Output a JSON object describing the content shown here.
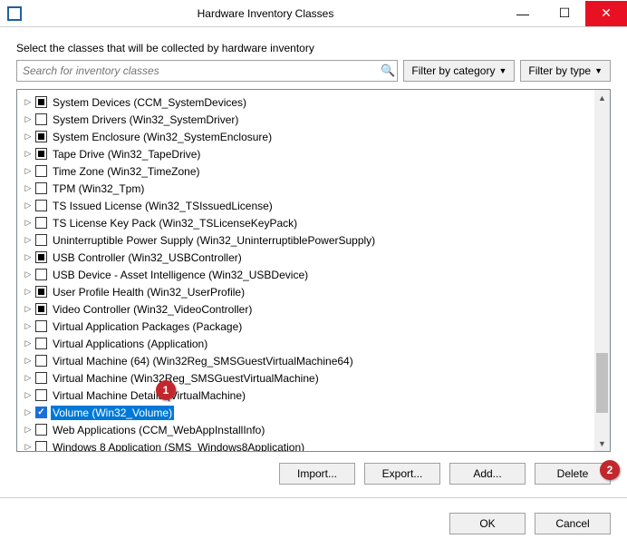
{
  "window": {
    "title": "Hardware Inventory Classes"
  },
  "instruction": "Select the classes that will be collected by hardware inventory",
  "search": {
    "placeholder": "Search for inventory classes"
  },
  "filters": {
    "category": "Filter by category",
    "type": "Filter by type"
  },
  "classes": [
    {
      "label": "System Devices (CCM_SystemDevices)",
      "state": "partial",
      "selected": false
    },
    {
      "label": "System Drivers (Win32_SystemDriver)",
      "state": "unchecked",
      "selected": false
    },
    {
      "label": "System Enclosure (Win32_SystemEnclosure)",
      "state": "partial",
      "selected": false
    },
    {
      "label": "Tape Drive (Win32_TapeDrive)",
      "state": "partial",
      "selected": false
    },
    {
      "label": "Time Zone (Win32_TimeZone)",
      "state": "unchecked",
      "selected": false
    },
    {
      "label": "TPM (Win32_Tpm)",
      "state": "unchecked",
      "selected": false
    },
    {
      "label": "TS Issued License (Win32_TSIssuedLicense)",
      "state": "unchecked",
      "selected": false
    },
    {
      "label": "TS License Key Pack (Win32_TSLicenseKeyPack)",
      "state": "unchecked",
      "selected": false
    },
    {
      "label": "Uninterruptible Power Supply (Win32_UninterruptiblePowerSupply)",
      "state": "unchecked",
      "selected": false
    },
    {
      "label": "USB Controller (Win32_USBController)",
      "state": "partial",
      "selected": false
    },
    {
      "label": "USB Device - Asset Intelligence (Win32_USBDevice)",
      "state": "unchecked",
      "selected": false
    },
    {
      "label": "User Profile Health (Win32_UserProfile)",
      "state": "partial",
      "selected": false
    },
    {
      "label": "Video Controller (Win32_VideoController)",
      "state": "partial",
      "selected": false
    },
    {
      "label": "Virtual Application Packages (Package)",
      "state": "unchecked",
      "selected": false
    },
    {
      "label": "Virtual Applications (Application)",
      "state": "unchecked",
      "selected": false
    },
    {
      "label": "Virtual Machine (64) (Win32Reg_SMSGuestVirtualMachine64)",
      "state": "unchecked",
      "selected": false
    },
    {
      "label": "Virtual Machine (Win32Reg_SMSGuestVirtualMachine)",
      "state": "unchecked",
      "selected": false
    },
    {
      "label": "Virtual Machine Details (VirtualMachine)",
      "state": "unchecked",
      "selected": false
    },
    {
      "label": "Volume (Win32_Volume)",
      "state": "checked",
      "selected": true
    },
    {
      "label": "Web Applications (CCM_WebAppInstallInfo)",
      "state": "unchecked",
      "selected": false
    },
    {
      "label": "Windows 8 Application (SMS_Windows8Application)",
      "state": "unchecked",
      "selected": false
    }
  ],
  "buttons": {
    "import": "Import...",
    "export": "Export...",
    "add": "Add...",
    "delete": "Delete",
    "ok": "OK",
    "cancel": "Cancel"
  },
  "badges": {
    "b1": "1",
    "b2": "2"
  }
}
